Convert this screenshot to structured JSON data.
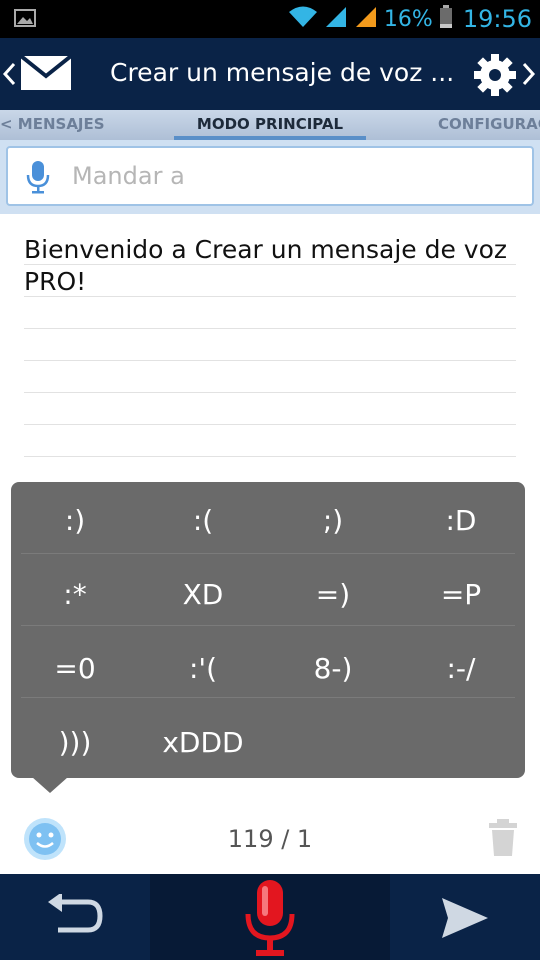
{
  "status_bar": {
    "battery": "16%",
    "time": "19:56"
  },
  "app_bar": {
    "title": "Crear un mensaje de voz ..."
  },
  "tabs": [
    {
      "label": "< MENSAJES"
    },
    {
      "label": "MODO PRINCIPAL"
    },
    {
      "label": "CONFIGURAC"
    }
  ],
  "search": {
    "placeholder": "Mandar a"
  },
  "message": {
    "text": "Bienvenido a Crear un mensaje de voz PRO!"
  },
  "emoticons": [
    ":)",
    ":(",
    ";)",
    ":D",
    ":*",
    "XD",
    "=)",
    "=P",
    "=0",
    ":'(",
    "8-)",
    ":-/",
    ")))",
    "xDDD"
  ],
  "footer": {
    "counter": "119 / 1"
  },
  "colors": {
    "app_bar": "#0a2347",
    "status_accent": "#33b5e5",
    "mic_red": "#e3161f",
    "panel": "#6a6a6a"
  }
}
